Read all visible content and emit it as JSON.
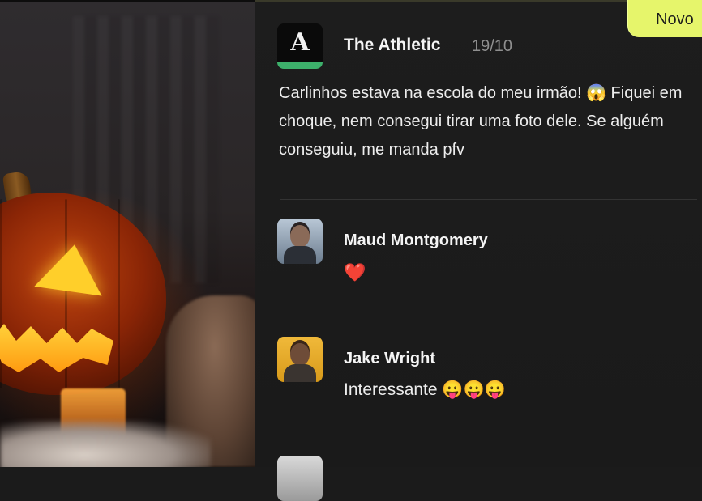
{
  "badge": {
    "label": "Novo"
  },
  "post": {
    "author": "The Athletic",
    "logo_letter": "A",
    "date": "19/10",
    "text": "Carlinhos estava na escola do meu irmão! 😱 Fiquei em choque, nem consegui tirar uma foto dele. Se alguém conseguiu, me manda pfv"
  },
  "comments": [
    {
      "name": "Maud Montgomery",
      "text": "❤️"
    },
    {
      "name": "Jake Wright",
      "text": "Interessante 😛😛😛"
    }
  ],
  "colors": {
    "panel_bg": "#1b1b1b",
    "badge_bg": "#e6f56b",
    "logo_stripe": "#3db06b",
    "heart": "#e3343c"
  }
}
